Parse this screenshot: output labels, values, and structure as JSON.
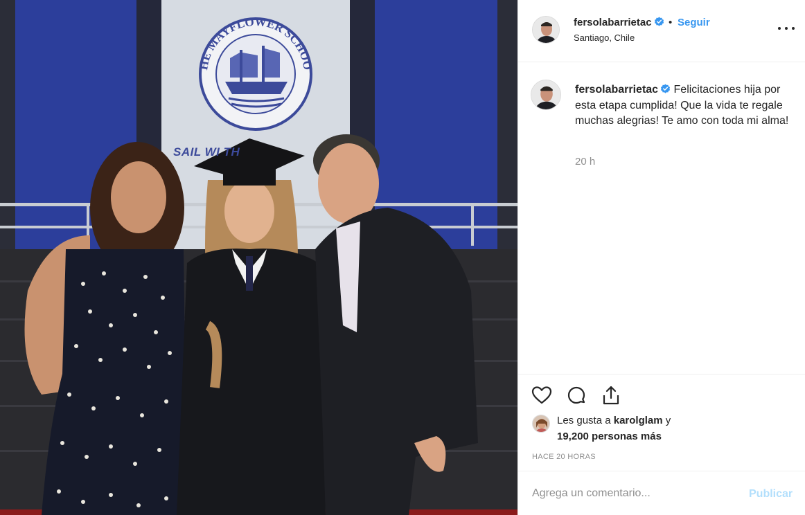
{
  "photo": {
    "banner_title": "THE MAYFLOWER SCHOOL",
    "banner_motto": "SAIL WI      TH"
  },
  "header": {
    "username": "fersolabarrietac",
    "separator": "•",
    "follow_label": "Seguir",
    "location": "Santiago, Chile",
    "verified_icon": "verified-badge-icon",
    "more_icon": "more-options-icon"
  },
  "caption": {
    "username": "fersolabarrietac",
    "text": "Felicitaciones hija por esta etapa cumplida! Que la vida te regale muchas alegrias! Te amo con toda mi alma!",
    "time": "20 h"
  },
  "actions": {
    "like_icon": "heart-icon",
    "comment_icon": "comment-bubble-icon",
    "share_icon": "share-icon"
  },
  "likes": {
    "prefix": "Les gusta a",
    "user": "karolglam",
    "conjunction": "y",
    "count_text": "19,200 personas más"
  },
  "timestamp": "HACE 20 HORAS",
  "comment_box": {
    "placeholder": "Agrega un comentario...",
    "publish_label": "Publicar"
  },
  "colors": {
    "accent": "#3897f0",
    "verified": "#3897f0",
    "publish_disabled": "#b2dffc",
    "muted": "#8e8e8e",
    "border": "#efefef"
  }
}
